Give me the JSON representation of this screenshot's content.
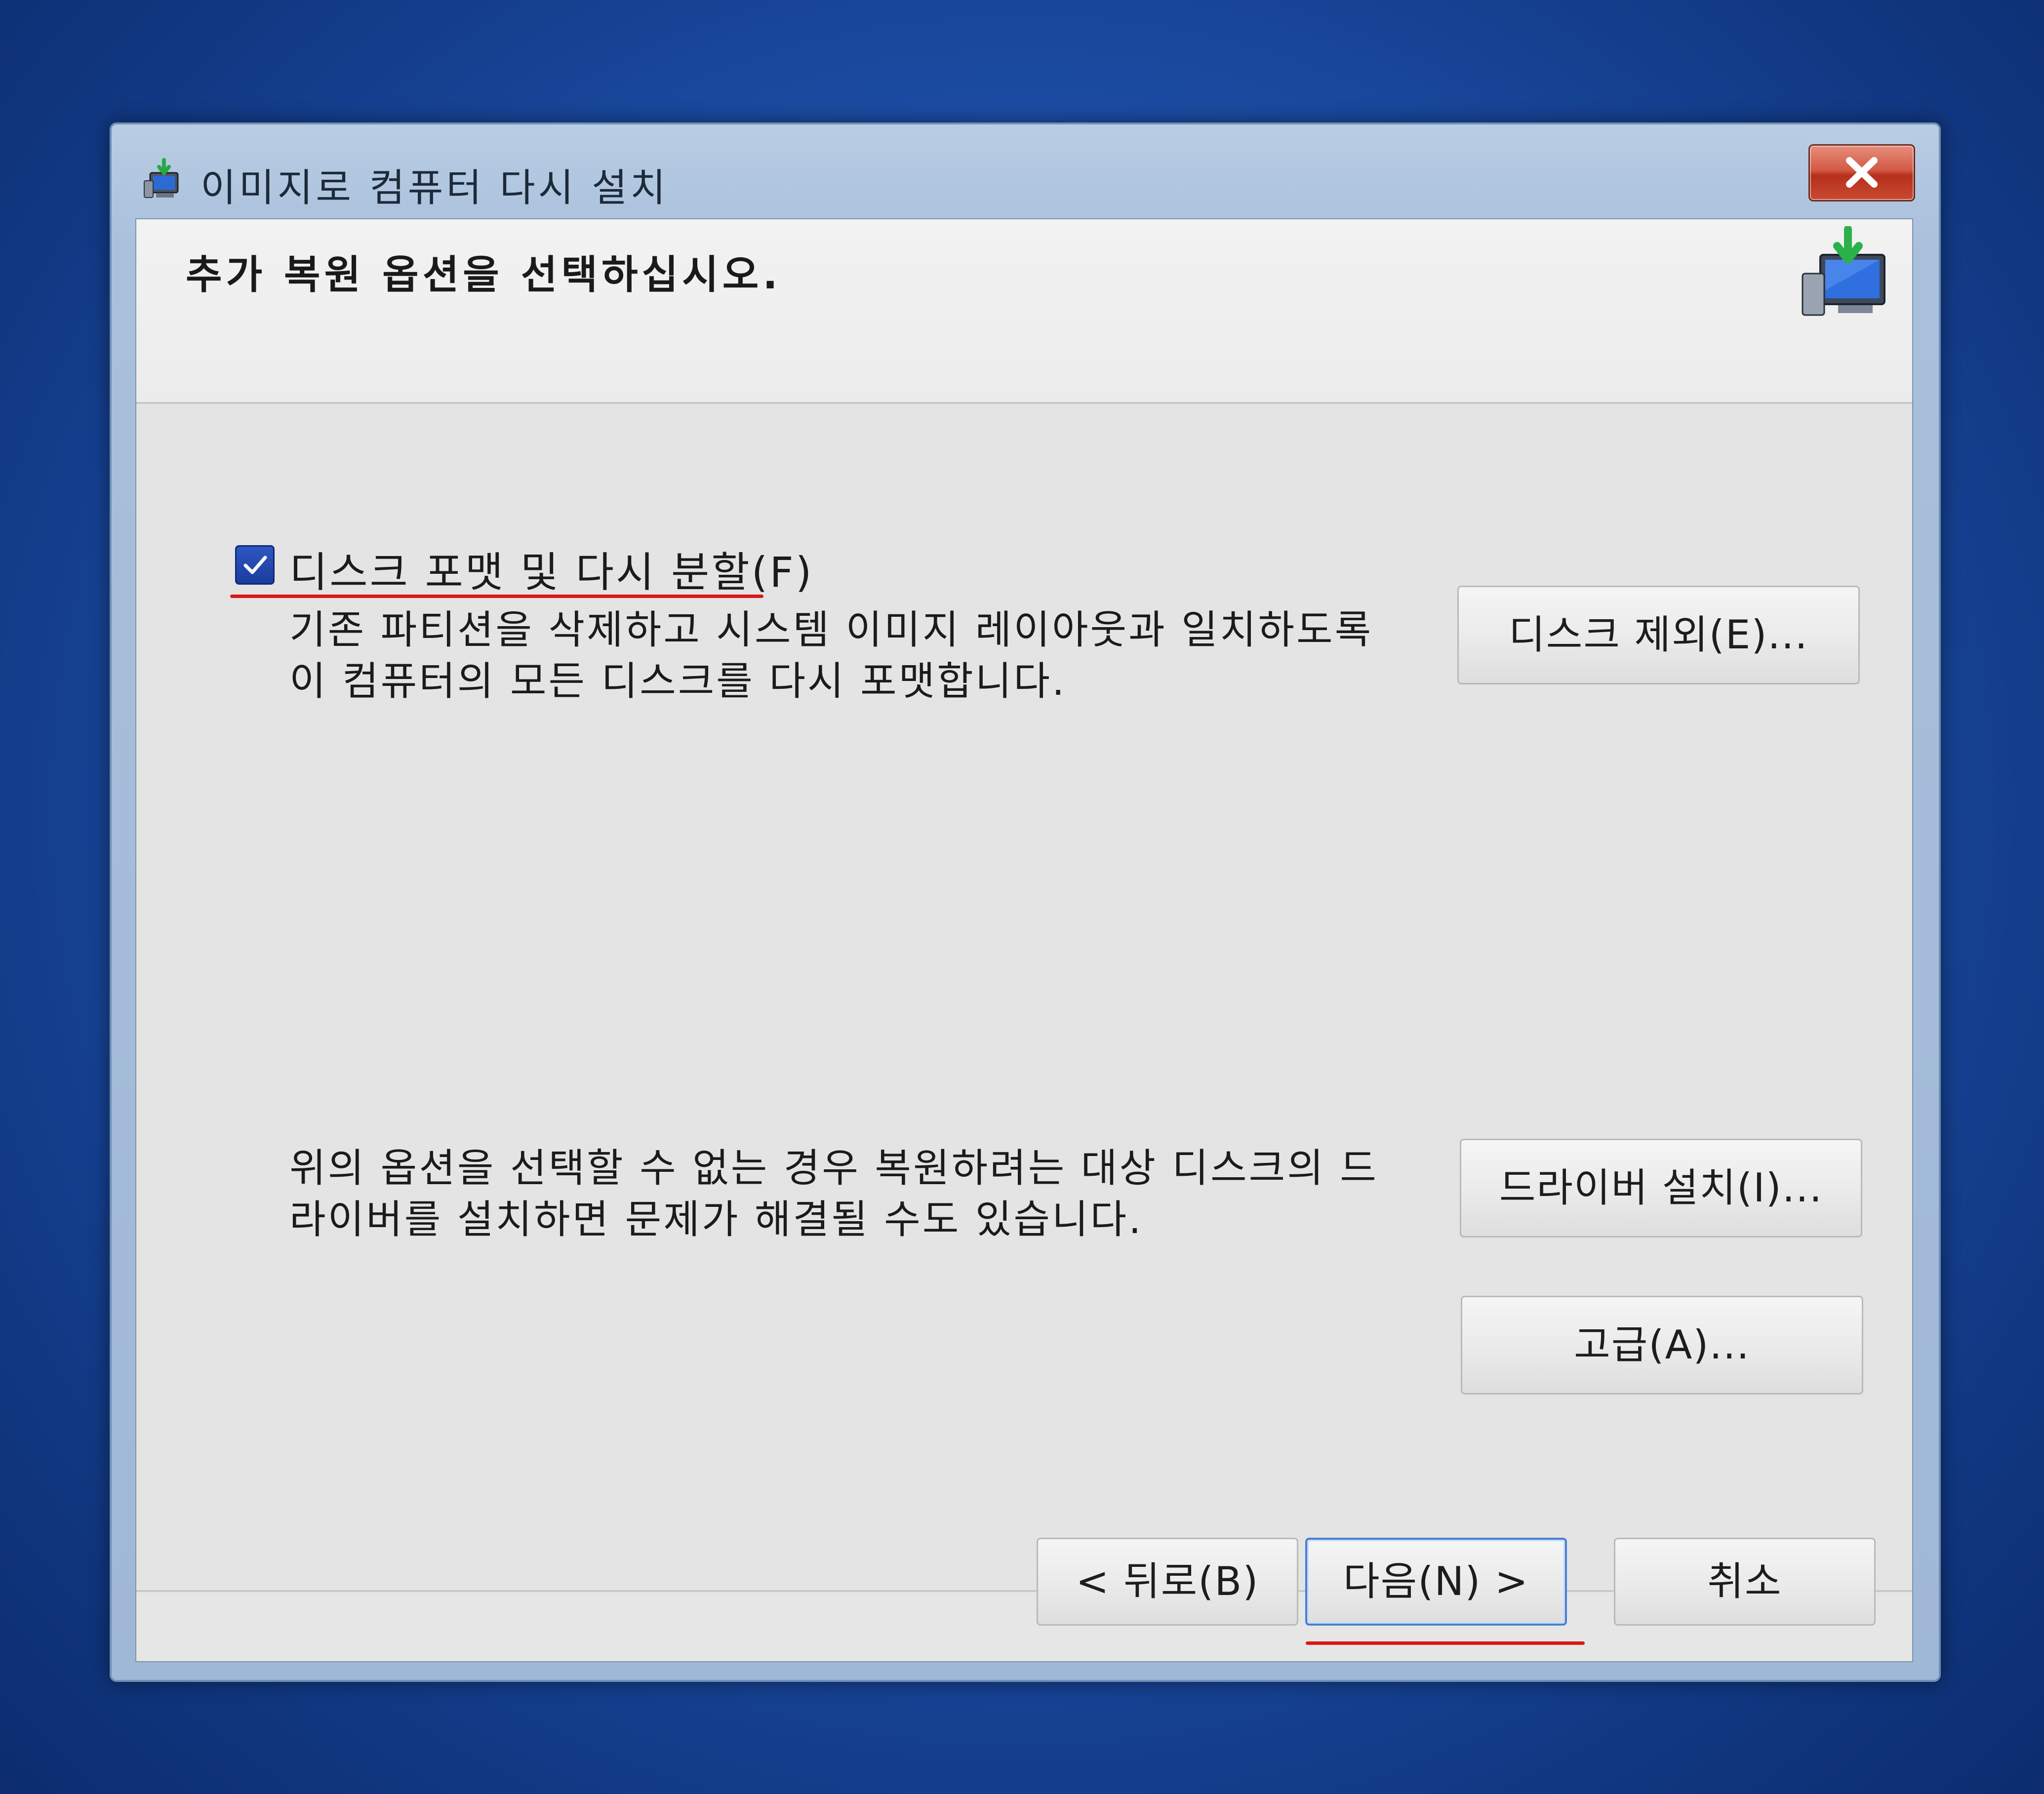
{
  "window": {
    "title": "이미지로 컴퓨터 다시 설치",
    "close_label": "X"
  },
  "header": {
    "title": "추가 복원 옵션을 선택하십시오."
  },
  "format_option": {
    "label": "디스크 포맷 및 다시 분할(F)",
    "checked": true,
    "description_line1": "기존 파티션을 삭제하고 시스템 이미지 레이아웃과 일치하도록",
    "description_line2": "이 컴퓨터의 모든 디스크를 다시 포맷합니다."
  },
  "exclude_disks_button": "디스크 제외(E)...",
  "driver_note": {
    "line1": "위의 옵션을 선택할 수 없는 경우 복원하려는 대상 디스크의 드",
    "line2": "라이버를 설치하면 문제가 해결될 수도 있습니다."
  },
  "install_driver_button": "드라이버 설치(I)...",
  "advanced_button": "고급(A)...",
  "footer": {
    "back_button": "< 뒤로(B)",
    "next_button": "다음(N) >",
    "cancel_button": "취소"
  },
  "colors": {
    "desktop": "#1d4fa8",
    "annotation": "#d81a1a",
    "checkbox": "#2f57c2",
    "close_button": "#c94a30"
  }
}
